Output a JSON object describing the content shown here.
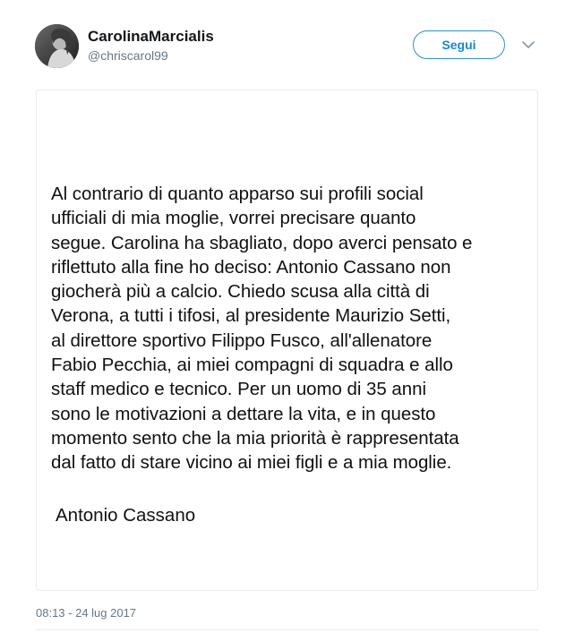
{
  "tweet": {
    "author": {
      "display_name": "CarolinaMarcialis",
      "handle": "@chriscarol99"
    },
    "follow_label": "Segui",
    "media_text": "Al contrario di quanto apparso sui profili social\nufficiali di mia moglie, vorrei precisare quanto\nsegue. Carolina ha sbagliato, dopo averci pensato e\nriflettuto alla fine ho deciso: Antonio Cassano non\ngiocherà più a calcio. Chiedo scusa alla città di\nVerona, a tutti i tifosi, al presidente  Maurizio Setti,\nal direttore sportivo Filippo Fusco, all'allenatore\nFabio Pecchia, ai miei compagni di squadra e allo\nstaff medico e tecnico. Per un uomo di 35 anni\nsono le motivazioni a dettare la vita, e in questo\nmomento sento che la mia priorità è rappresentata\ndal fatto di stare vicino ai miei figli e a mia moglie.",
    "signature": "Antonio Cassano",
    "timestamp": "08:13 - 24 lug 2017"
  },
  "icons": {
    "avatar": "avatar",
    "more": "chevron-down-icon"
  },
  "colors": {
    "accent": "#1da1f2",
    "text": "#14171a",
    "secondary_text": "#657786",
    "border": "#e6ecf0"
  }
}
